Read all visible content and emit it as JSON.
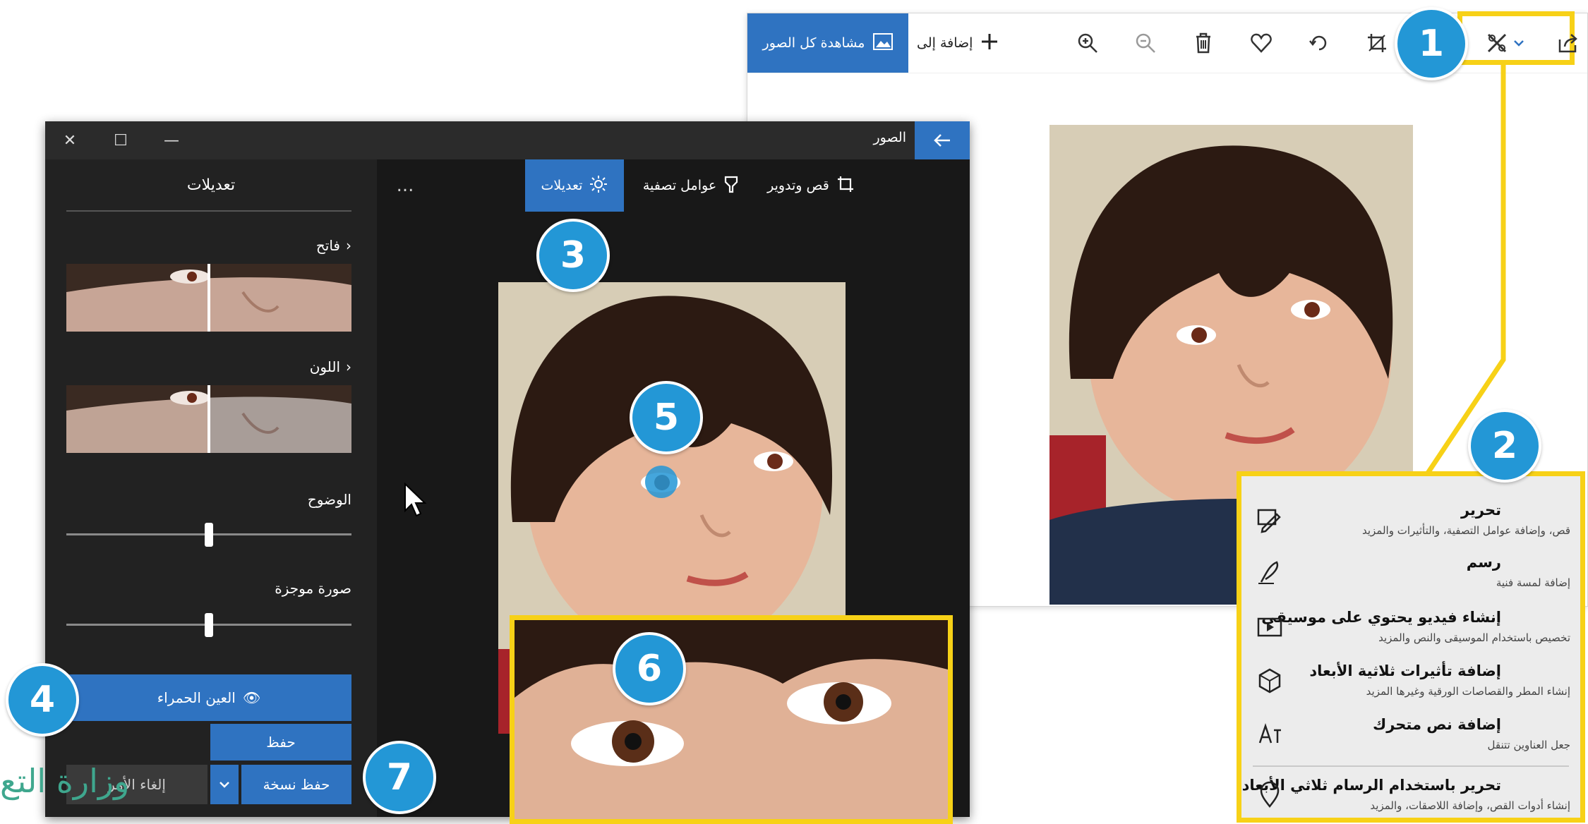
{
  "viewer": {
    "see_all_label": "مشاهدة كل الصور",
    "add_to_label": "إضافة إلى",
    "toolbar_icons": [
      "zoom-in-icon",
      "zoom-out-icon",
      "delete-icon",
      "heart-icon",
      "rotate-icon",
      "crop-icon",
      "edit-create-icon",
      "chevron-down-icon",
      "share-icon"
    ]
  },
  "editor": {
    "app_title": "الصور",
    "tabs": [
      {
        "label": "قص وتدوير",
        "icon": "crop-rotate-icon"
      },
      {
        "label": "عوامل تصفية",
        "icon": "filter-icon"
      },
      {
        "label": "تعديلات",
        "icon": "brightness-icon"
      }
    ],
    "more_label": "...",
    "panel": {
      "title": "تعديلات",
      "light_label": "فاتح",
      "color_label": "اللون",
      "clarity_label": "الوضوح",
      "clarity_value": 0.5,
      "vignette_label": "صورة موجزة",
      "vignette_value": 0.5,
      "red_eye_label": "العين الحمراء",
      "save_label": "حفظ",
      "cancel_label": "إلغاء الأمر",
      "save_copy_label": "حفظ نسخة"
    }
  },
  "menu": {
    "items": [
      {
        "title": "تحرير",
        "subtitle": "قص، وإضافة عوامل التصفية، والتأثيرات والمزيد",
        "icon": "edit-icon"
      },
      {
        "title": "رسم",
        "subtitle": "إضافة لمسة فنية",
        "icon": "pen-icon"
      },
      {
        "title": "إنشاء فيديو يحتوي على موسيقى",
        "subtitle": "تخصيص باستخدام الموسيقى والنص والمزيد",
        "icon": "video-icon"
      },
      {
        "title": "إضافة تأثيرات ثلاثية الأبعاد",
        "subtitle": "إنشاء المطر والقصاصات الورقية وغيرها المزيد",
        "icon": "3d-effects-icon"
      },
      {
        "title": "إضافة نص متحرك",
        "subtitle": "جعل العناوين تتنقل",
        "icon": "animated-text-icon"
      },
      {
        "title": "تحرير باستخدام الرسام ثلاثي الأبعاد",
        "subtitle": "إنشاء أدوات القص، وإضافة اللاصقات، والمزيد",
        "icon": "paint3d-icon"
      }
    ]
  },
  "callouts": [
    "1",
    "2",
    "3",
    "4",
    "5",
    "6",
    "7"
  ],
  "watermark": "وزارة التع",
  "colors": {
    "accent": "#2f73c1",
    "callout": "#2397d6",
    "highlight": "#f7d117",
    "editor_bg": "#1e1e1e"
  }
}
